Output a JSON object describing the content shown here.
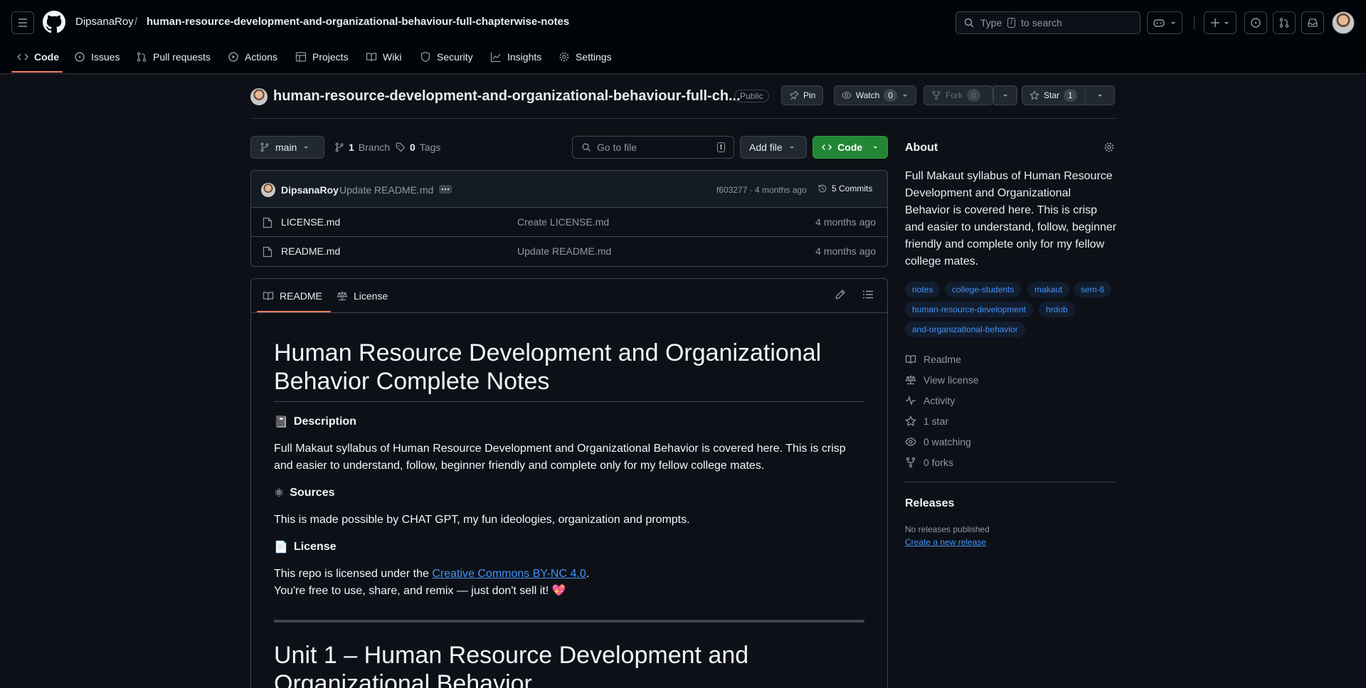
{
  "header": {
    "owner": "DipsanaRoy",
    "separator": "/",
    "repo": "human-resource-development-and-organizational-behaviour-full-chapterwise-notes",
    "search_prefix": "Type",
    "search_key": "/",
    "search_suffix": "to search"
  },
  "nav": {
    "code": "Code",
    "issues": "Issues",
    "pulls": "Pull requests",
    "actions": "Actions",
    "projects": "Projects",
    "wiki": "Wiki",
    "security": "Security",
    "insights": "Insights",
    "settings": "Settings"
  },
  "repo": {
    "title": "human-resource-development-and-organizational-behaviour-full-ch...",
    "visibility": "Public",
    "pin": "Pin",
    "watch": "Watch",
    "watch_count": "0",
    "fork": "Fork",
    "fork_count": "0",
    "star": "Star",
    "star_count": "1"
  },
  "toolbar": {
    "branch": "main",
    "branch_count": "1",
    "branch_label": "Branch",
    "tag_count": "0",
    "tag_label": "Tags",
    "goto_placeholder": "Go to file",
    "goto_key": "t",
    "add_file": "Add file",
    "code": "Code"
  },
  "commit": {
    "author": "DipsanaRoy",
    "message": "Update README.md",
    "meta": "f603277 · 4 months ago",
    "commits": "5 Commits"
  },
  "files": [
    {
      "name": "LICENSE.md",
      "message": "Create LICENSE.md",
      "age": "4 months ago"
    },
    {
      "name": "README.md",
      "message": "Update README.md",
      "age": "4 months ago"
    }
  ],
  "readme": {
    "tab_readme": "README",
    "tab_license": "License",
    "title_line1": "Human Resource Development and Organizational",
    "title_line2": "Behavior Complete Notes",
    "desc_icon": "📓",
    "desc_heading": "Description",
    "desc_text": "Full Makaut syllabus of Human Resource Development and Organizational Behavior is covered here. This is crisp and easier to understand, follow, beginner friendly and complete only for my fellow college mates.",
    "sources_icon": "⚛",
    "sources_heading": "Sources",
    "sources_text": "This is made possible by CHAT GPT, my fun ideologies, organization and prompts.",
    "license_icon": "📄",
    "license_heading": "License",
    "license_prefix": "This repo is licensed under the ",
    "license_link": "Creative Commons BY-NC 4.0",
    "license_suffix": ".",
    "license_note": "You're free to use, share, and remix — just don't sell it! 💖",
    "unit_line1": "Unit 1 – Human Resource Development and",
    "unit_line2": "Organizational Behavior"
  },
  "about": {
    "heading": "About",
    "description": "Full Makaut syllabus of Human Resource Development and Organizational Behavior is covered here. This is crisp and easier to understand, follow, beginner friendly and complete only for my fellow college mates.",
    "topics": [
      "notes",
      "college-students",
      "makaut",
      "sem-6",
      "human-resource-development",
      "hrdob",
      "and-organizational-behavior"
    ],
    "readme": "Readme",
    "license": "View license",
    "activity": "Activity",
    "stars": "1 star",
    "watching": "0 watching",
    "forks": "0 forks"
  },
  "releases": {
    "heading": "Releases",
    "none": "No releases published",
    "create": "Create a new release"
  }
}
